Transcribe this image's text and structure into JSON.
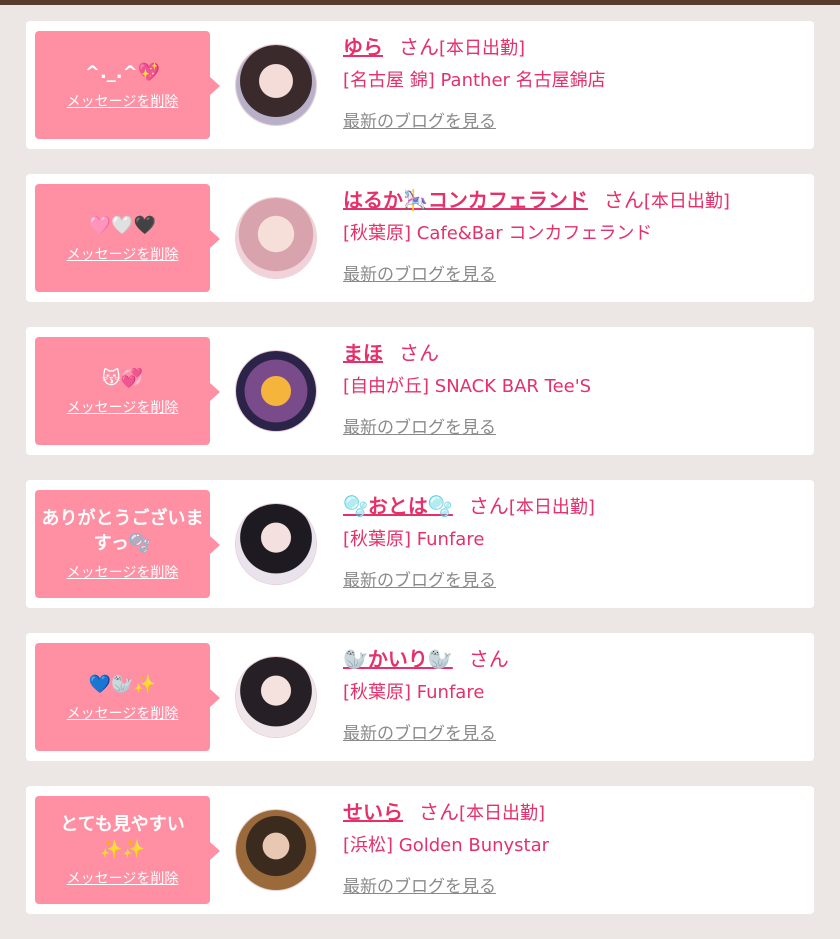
{
  "cards": [
    {
      "message": "^._.^💖",
      "delete_label": "メッセージを削除",
      "name": "ゆら",
      "honorific": "さん",
      "working": "[本日出勤]",
      "shop": "[名古屋 錦] Panther 名古屋錦店",
      "blog_label": "最新のブログを見る"
    },
    {
      "message": "🩷🤍🖤",
      "delete_label": "メッセージを削除",
      "name": "はるか🎠コンカフェランド",
      "honorific": "さん",
      "working": "[本日出勤]",
      "shop": "[秋葉原] Cafe&Bar コンカフェランド",
      "blog_label": "最新のブログを見る"
    },
    {
      "message": "😽💞",
      "delete_label": "メッセージを削除",
      "name": "まほ",
      "honorific": "さん",
      "working": "",
      "shop": "[自由が丘] SNACK BAR Tee'S",
      "blog_label": "最新のブログを見る"
    },
    {
      "message": "ありがとうございますっ🫧",
      "delete_label": "メッセージを削除",
      "name": "🫧おとは🫧",
      "honorific": "さん",
      "working": "[本日出勤]",
      "shop": "[秋葉原] Funfare",
      "blog_label": "最新のブログを見る"
    },
    {
      "message": "💙🦭✨",
      "delete_label": "メッセージを削除",
      "name": "🦭かいり🦭",
      "honorific": "さん",
      "working": "",
      "shop": "[秋葉原] Funfare",
      "blog_label": "最新のブログを見る"
    },
    {
      "message": "とても見やすい✨✨",
      "delete_label": "メッセージを削除",
      "name": "せいら",
      "honorific": "さん",
      "working": "[本日出勤]",
      "shop": "[浜松] Golden Bunystar",
      "blog_label": "最新のブログを見る"
    }
  ],
  "colors": {
    "accent": "#e5306a",
    "bubble": "#ff8fa3",
    "background": "#ece7e5"
  }
}
